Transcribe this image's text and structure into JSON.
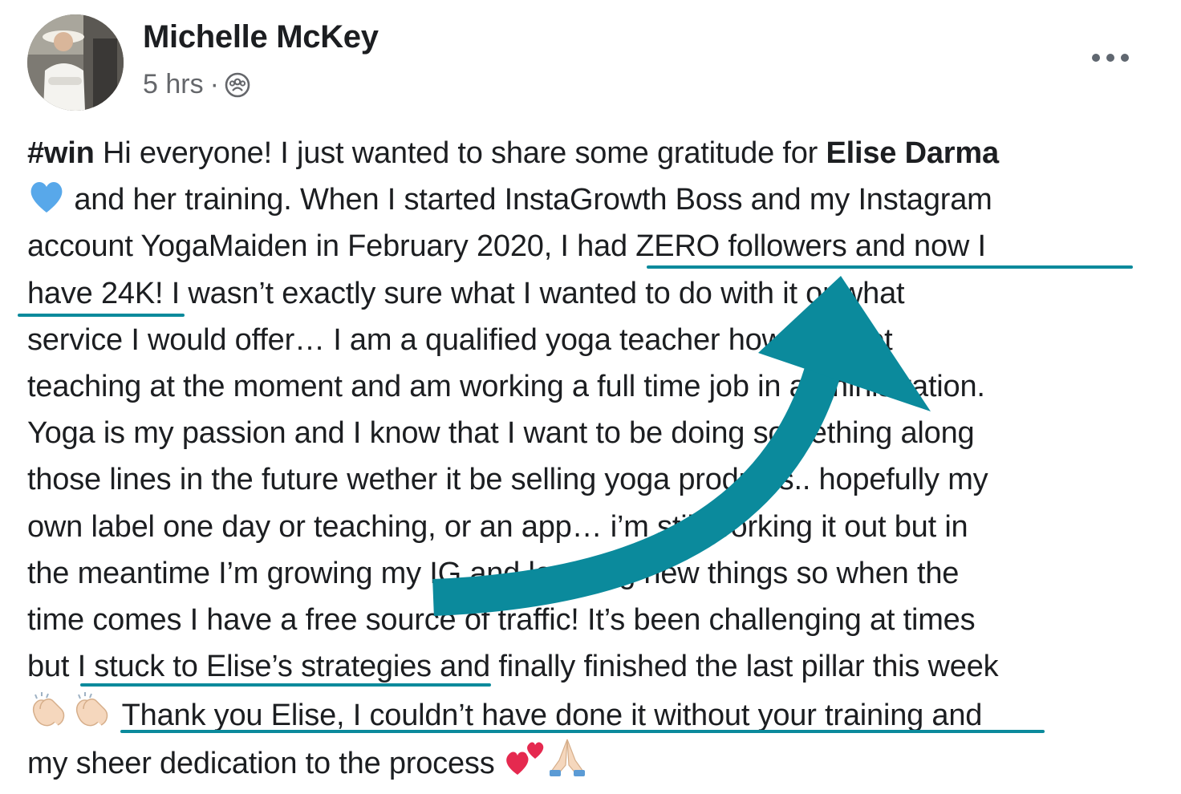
{
  "post": {
    "author": "Michelle McKey",
    "time": "5 hrs",
    "separator": "·",
    "audience_icon": "group-icon",
    "more_icon": "more-horizontal-icon",
    "lines": [
      [
        {
          "t": "#win",
          "b": true
        },
        {
          "t": " Hi everyone! I just wanted to share some gratitude for "
        },
        {
          "t": "Elise Darma",
          "b": true
        }
      ],
      [
        {
          "e": "blue-heart"
        },
        {
          "t": " and her training.  When I started  InstaGrowth Boss and my Instagram"
        }
      ],
      [
        {
          "t": "account YogaMaiden in February 2020, I had ZERO followers and now I"
        }
      ],
      [
        {
          "t": "have 24K! I wasn’t exactly sure what I wanted to do with it or what"
        }
      ],
      [
        {
          "t": "service I would offer… I am a qualified yoga teacher however not"
        }
      ],
      [
        {
          "t": "teaching at the moment and am working a full time job in administration."
        }
      ],
      [
        {
          "t": "Yoga is my passion and I know that I want to be doing something along"
        }
      ],
      [
        {
          "t": "those lines in the future wether it be selling yoga products.. hopefully my"
        }
      ],
      [
        {
          "t": "own label one day or teaching, or an app… i’m still working it out but in"
        }
      ],
      [
        {
          "t": "the meantime I’m growing my IG and learning new things so when the"
        }
      ],
      [
        {
          "t": "time comes I have a free source of traffic!  It’s been challenging at times"
        }
      ],
      [
        {
          "t": "but I stuck to Elise’s strategies and finally finished the last pillar this week"
        }
      ],
      [
        {
          "e": "clap"
        },
        {
          "e": "clap"
        },
        {
          "t": " Thank you Elise, I couldn’t have done it without your training and"
        }
      ],
      [
        {
          "t": "my sheer dedication to the process "
        },
        {
          "e": "hearts"
        },
        {
          "e": "pray"
        }
      ]
    ]
  },
  "annotation": {
    "color": "#0b8a9c"
  }
}
